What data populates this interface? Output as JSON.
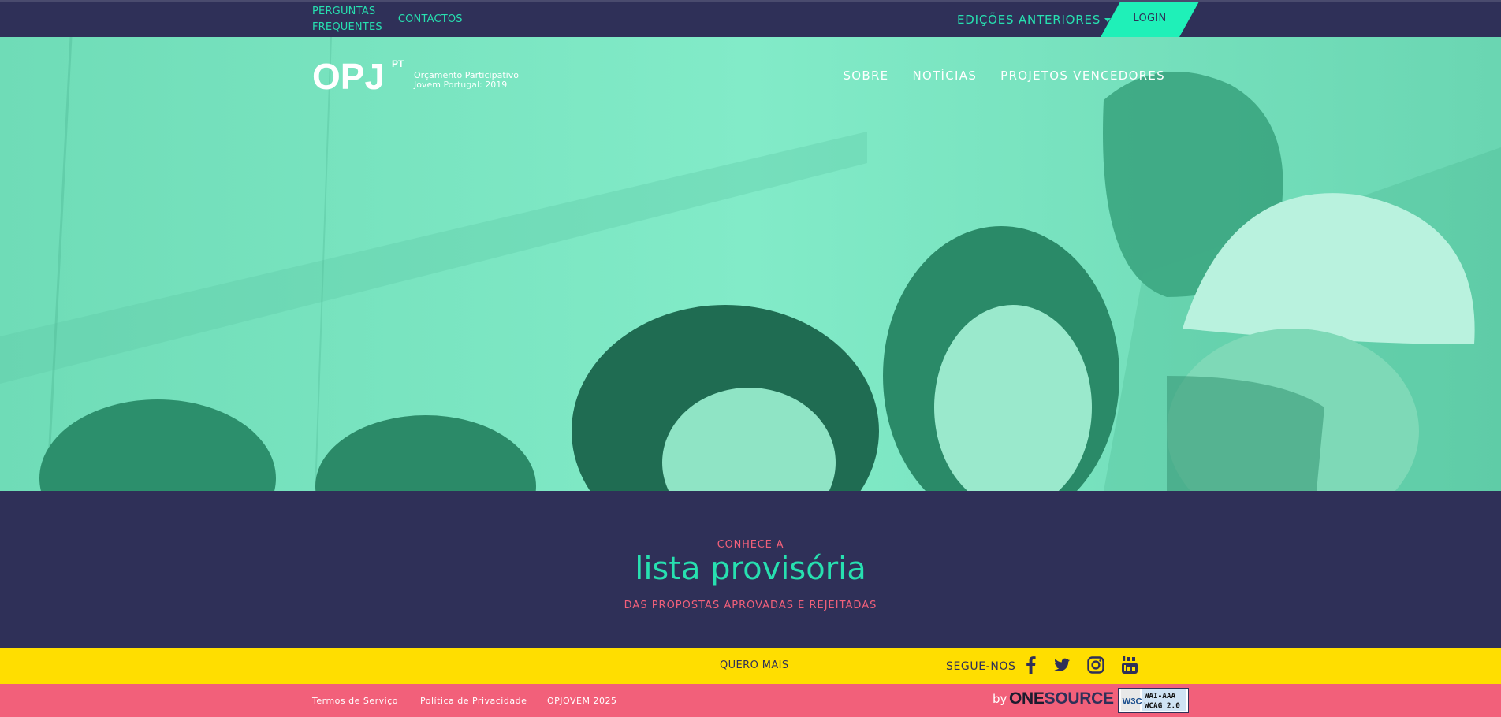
{
  "topbar": {
    "faq_label": "PERGUNTAS\nFREQUENTES",
    "contacts_label": "CONTACTOS",
    "editions_label": "EDIÇÕES ANTERIORES",
    "login_label": "LOGIN"
  },
  "logo": {
    "mark": "OPJ",
    "superscript": "PT",
    "line1": "Orçamento Participativo",
    "line2a": "Jovem",
    "line2b": "Portugal",
    "line2c": "20",
    "line2d": "19"
  },
  "nav": {
    "items": [
      {
        "label": "SOBRE"
      },
      {
        "label": "NOTÍCIAS"
      },
      {
        "label": "PROJETOS VENCEDORES"
      }
    ]
  },
  "promo": {
    "kicker": "CONHECE A",
    "headline": "lista provisória",
    "subline": "DAS PROPOSTAS APROVADAS E REJEITADAS"
  },
  "yellowbar": {
    "quero_label": "QUERO MAIS",
    "follow_label": "SEGUE-NOS"
  },
  "footer": {
    "terms_label": "Termos de Serviço",
    "privacy_label": "Política de Privacidade",
    "copyright": "OPJOVEM 2025",
    "by_label": "by",
    "brand_one": "ONE",
    "brand_source": "SOURCE",
    "w3c_line1": "WAI-AAA",
    "w3c_line2": "WCAG 2.0"
  },
  "icons": [
    "caret-down-icon",
    "facebook-icon",
    "twitter-icon",
    "instagram-icon",
    "youtube-icon"
  ],
  "colors": {
    "navy": "#2f3058",
    "mint": "#27e0b0",
    "hero_tint": "#7ce8c4",
    "pink": "#f2607a",
    "yellow": "#ffde00"
  }
}
